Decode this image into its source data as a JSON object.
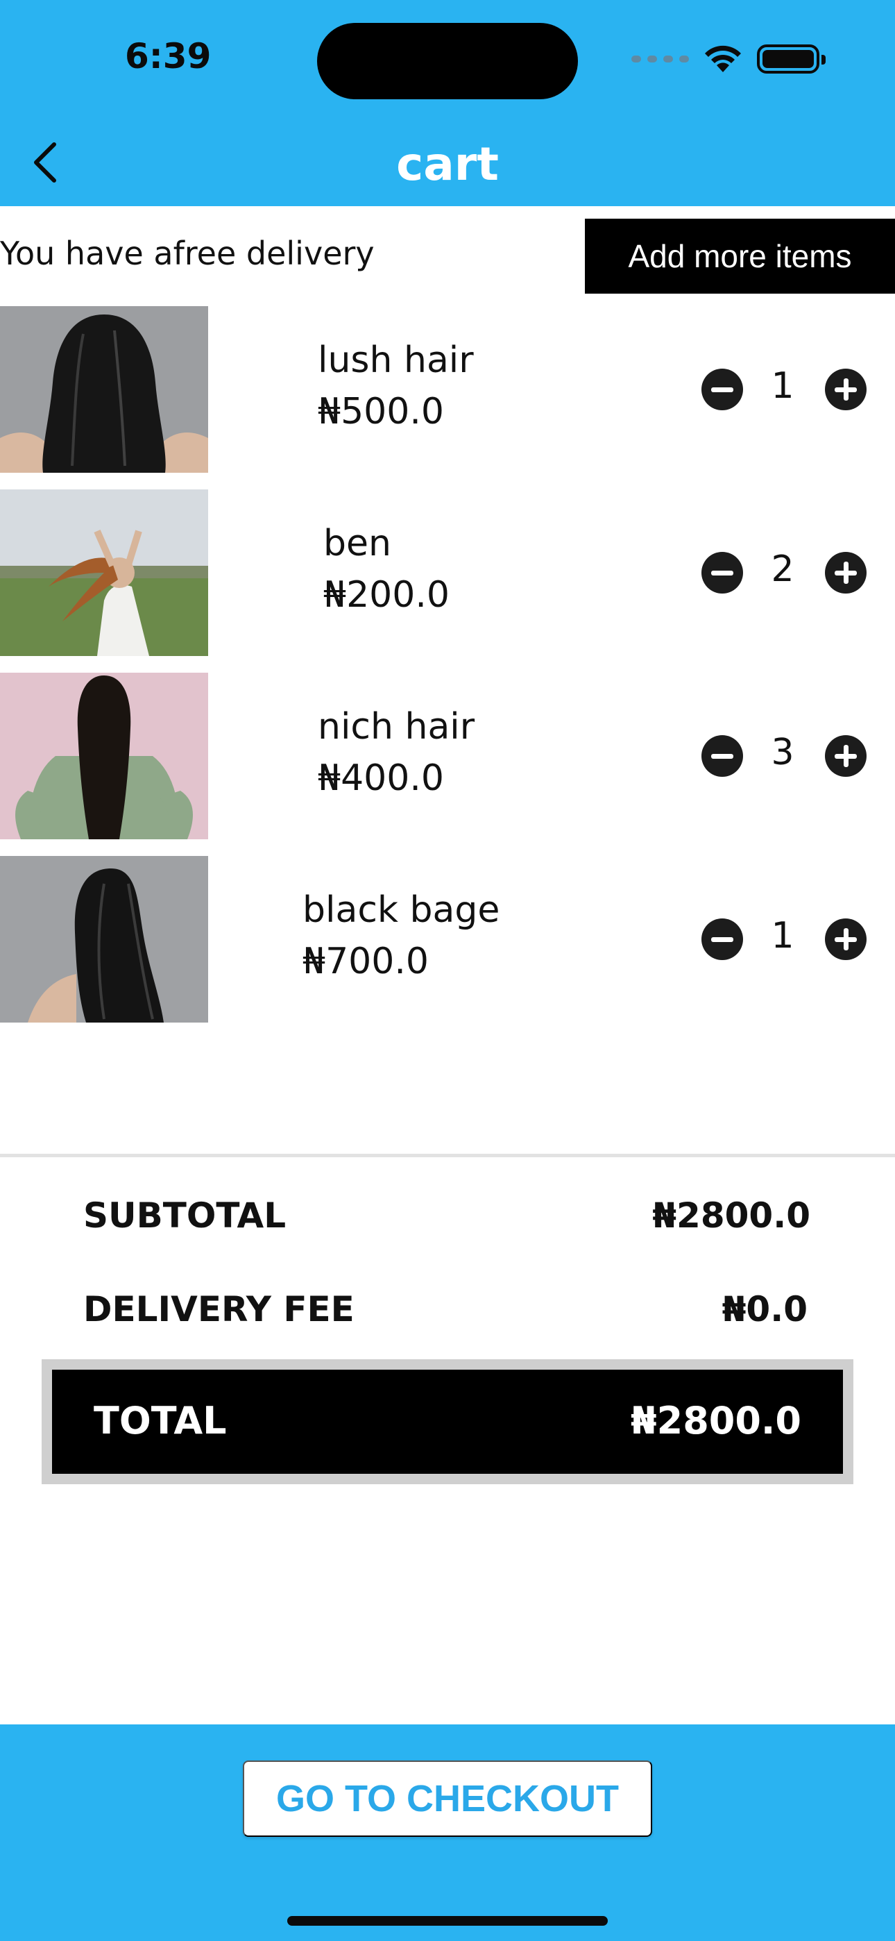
{
  "status_bar": {
    "time": "6:39"
  },
  "header": {
    "title": "cart",
    "back_icon": "chevron-left-icon"
  },
  "delivery": {
    "message": "You have afree delivery",
    "add_more_label": "Add more items"
  },
  "items": [
    {
      "name": "lush hair",
      "price": "₦500.0",
      "quantity": "1",
      "image": "straight-black-hair-photo"
    },
    {
      "name": "ben",
      "price": "₦200.0",
      "quantity": "2",
      "image": "woman-field-hair-photo"
    },
    {
      "name": "nich hair",
      "price": "₦400.0",
      "quantity": "3",
      "image": "long-hair-green-jacket-photo"
    },
    {
      "name": "black bage",
      "price": "₦700.0",
      "quantity": "1",
      "image": "black-hair-side-photo"
    }
  ],
  "summary": {
    "subtotal_label": "SUBTOTAL",
    "subtotal_value": "₦2800.0",
    "delivery_label": "DELIVERY FEE",
    "delivery_value": "₦0.0",
    "total_label": "TOTAL",
    "total_value": "₦2800.0"
  },
  "footer": {
    "checkout_label": "GO TO CHECKOUT"
  },
  "colors": {
    "accent": "#2AB3F1",
    "button_dark": "#000000",
    "checkout_text": "#2AA8E9"
  }
}
